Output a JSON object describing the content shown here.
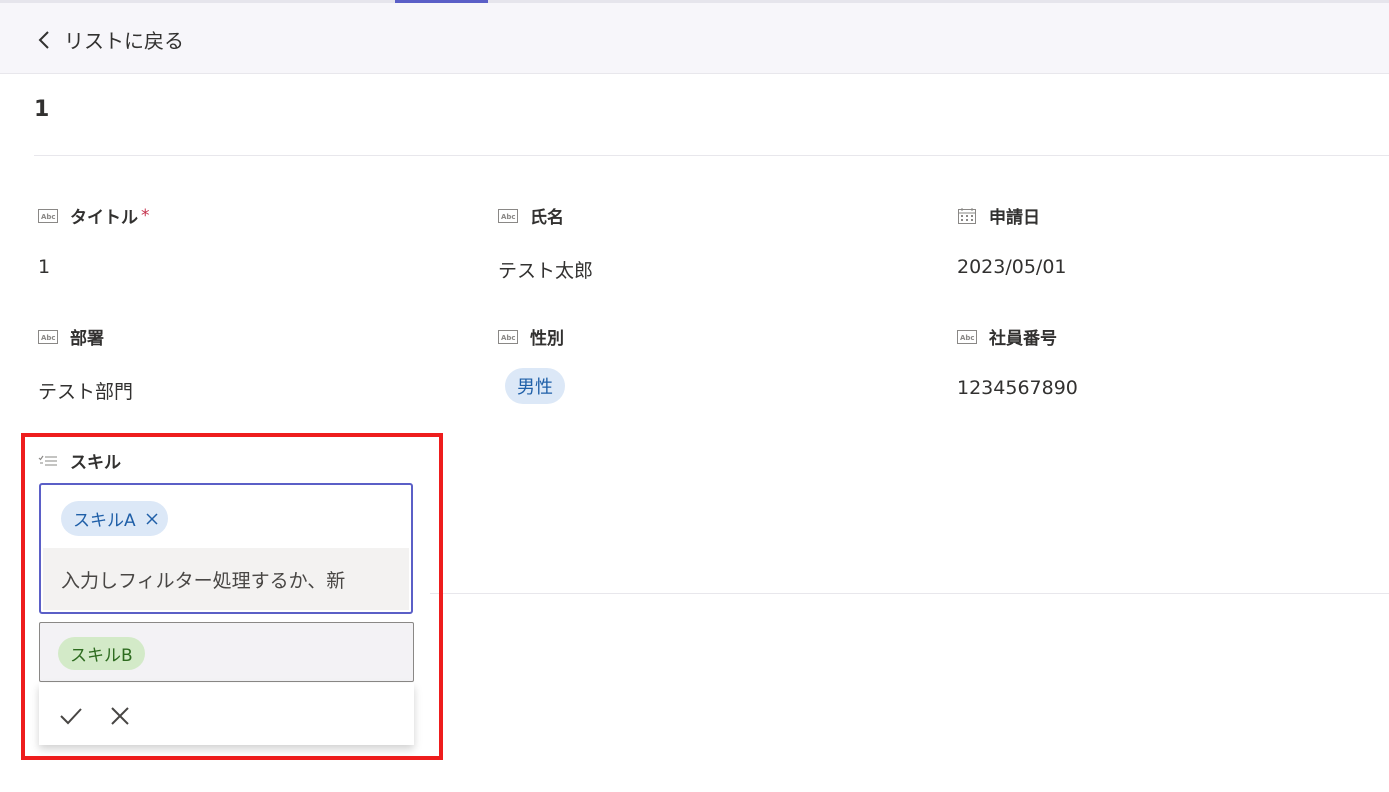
{
  "header": {
    "back_label": "リストに戻る"
  },
  "item": {
    "title": "1"
  },
  "fields": {
    "title": {
      "label": "タイトル",
      "required_mark": "*",
      "value": "1",
      "icon": "text-field-icon"
    },
    "name": {
      "label": "氏名",
      "value": "テスト太郎",
      "icon": "text-field-icon"
    },
    "apply_date": {
      "label": "申請日",
      "value": "2023/05/01",
      "icon": "calendar-icon"
    },
    "department": {
      "label": "部署",
      "value": "テスト部門",
      "icon": "text-field-icon"
    },
    "gender": {
      "label": "性別",
      "value": "男性",
      "icon": "text-field-icon"
    },
    "employee_no": {
      "label": "社員番号",
      "value": "1234567890",
      "icon": "text-field-icon"
    },
    "skill": {
      "label": "スキル",
      "icon": "multi-choice-icon",
      "selected": [
        "スキルA"
      ],
      "placeholder": "入力しフィルター処理するか、新",
      "options": [
        "スキルB"
      ]
    }
  },
  "colors": {
    "accent": "#5b5fc7",
    "highlight_box": "#ee1d1d",
    "required": "#c4314b",
    "chip_blue": "#dce8f7",
    "chip_green": "#d3eac8"
  }
}
